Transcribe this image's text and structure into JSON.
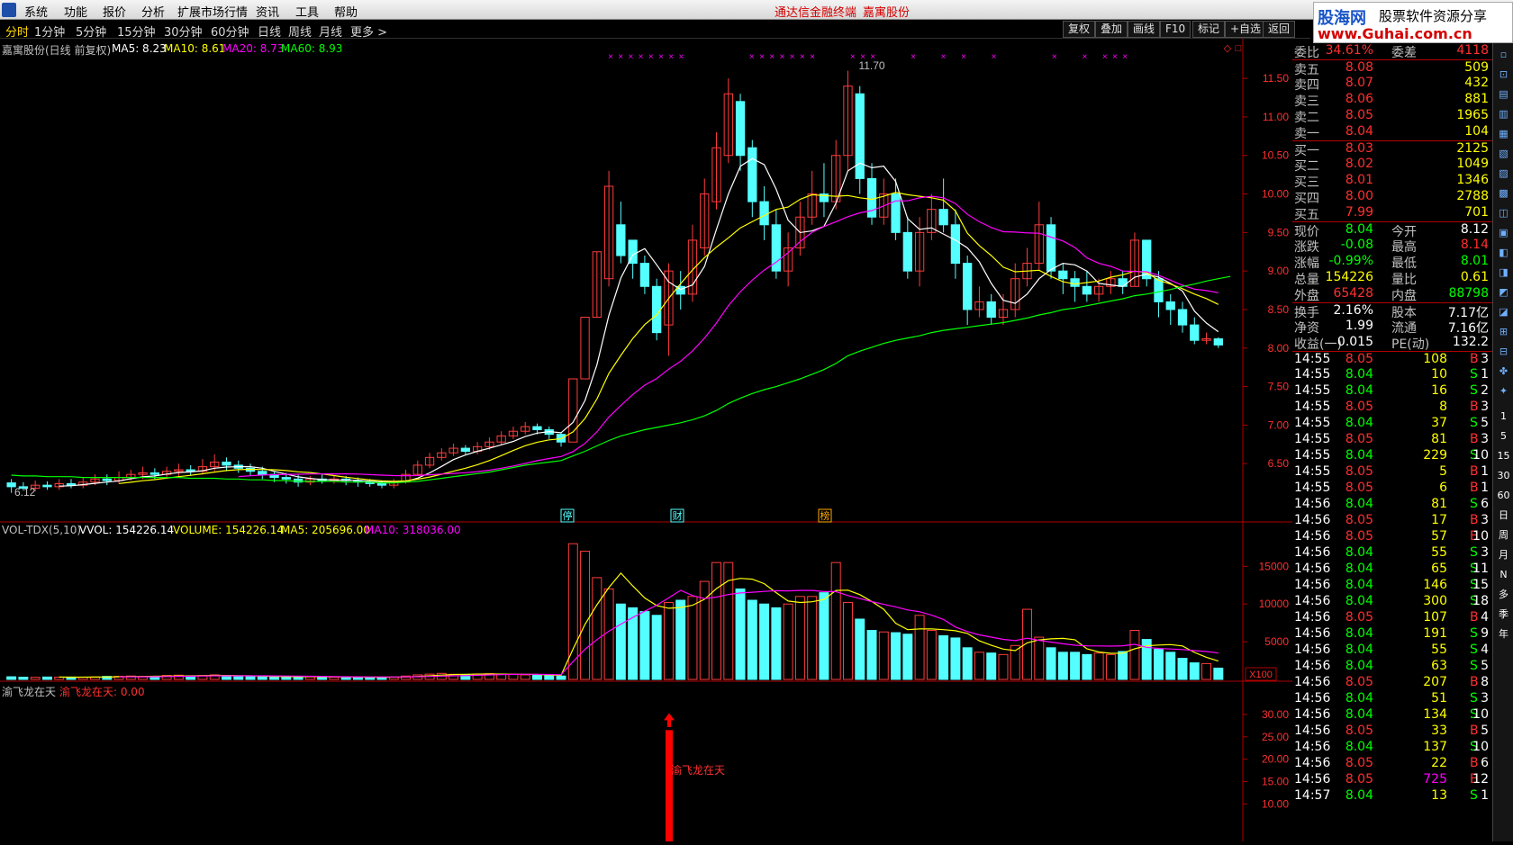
{
  "menu": {
    "items": [
      "系统",
      "功能",
      "报价",
      "分析",
      "扩展市场行情",
      "资讯",
      "工具",
      "帮助"
    ],
    "title": "通达信金融终端",
    "stock": "嘉寓股份"
  },
  "site_banner": {
    "brand": "股海网",
    "slogan": "股票软件资源分享",
    "url": "www.Guhai.com.cn"
  },
  "periods": [
    "分时",
    "1分钟",
    "5分钟",
    "15分钟",
    "30分钟",
    "60分钟",
    "日线",
    "周线",
    "月线",
    "更多 >"
  ],
  "active_period": "分时",
  "right_buttons": [
    "复权",
    "叠加",
    "画线",
    "F10",
    "标记",
    "+自选",
    "返回"
  ],
  "main_panel": {
    "stock_name": "嘉寓股份(日线 前复权)",
    "ma_labels": [
      {
        "text": "MA5: 8.23",
        "color": "#ffffff"
      },
      {
        "text": "MA10: 8.61",
        "color": "#ffff00"
      },
      {
        "text": "MA20: 8.73",
        "color": "#ff00ff"
      },
      {
        "text": "MA60: 8.93",
        "color": "#00ff00"
      }
    ],
    "high_label": "11.70",
    "low_label": "6.12",
    "event_markers": [
      "停",
      "财",
      "榜"
    ],
    "y_ticks": [
      "11.50",
      "11.00",
      "10.50",
      "10.00",
      "9.50",
      "9.00",
      "8.50",
      "8.00",
      "7.50",
      "7.00",
      "6.50"
    ]
  },
  "vol_panel": {
    "labels": [
      {
        "text": "VOL-TDX(5,10)",
        "color": "#c0c0c0"
      },
      {
        "text": "VVOL: 154226.14",
        "color": "#ffffff"
      },
      {
        "text": "VOLUME: 154226.14",
        "color": "#ffff00"
      },
      {
        "text": "MA5: 205696.00",
        "color": "#ffff00"
      },
      {
        "text": "MA10: 318036.00",
        "color": "#ff00ff"
      }
    ],
    "y_ticks": [
      "15000",
      "10000",
      "5000"
    ],
    "unit": "X100"
  },
  "indicator_panel": {
    "name": "渝飞龙在天",
    "value_label": "渝飞龙在天: 0.00",
    "signal_label": "渝飞龙在天",
    "y_ticks": [
      "30.00",
      "25.00",
      "20.00",
      "15.00",
      "10.00"
    ]
  },
  "chart_data": {
    "type": "candlestick",
    "y_range": [
      6.0,
      11.7
    ],
    "candles": [
      [
        6.25,
        6.2,
        6.3,
        6.12
      ],
      [
        6.2,
        6.18,
        6.26,
        6.15
      ],
      [
        6.18,
        6.22,
        6.28,
        6.14
      ],
      [
        6.22,
        6.2,
        6.27,
        6.16
      ],
      [
        6.2,
        6.24,
        6.3,
        6.16
      ],
      [
        6.24,
        6.22,
        6.3,
        6.18
      ],
      [
        6.22,
        6.26,
        6.32,
        6.18
      ],
      [
        6.26,
        6.3,
        6.36,
        6.22
      ],
      [
        6.3,
        6.28,
        6.36,
        6.22
      ],
      [
        6.28,
        6.32,
        6.4,
        6.24
      ],
      [
        6.32,
        6.36,
        6.42,
        6.28
      ],
      [
        6.36,
        6.38,
        6.46,
        6.3
      ],
      [
        6.38,
        6.36,
        6.44,
        6.3
      ],
      [
        6.36,
        6.4,
        6.46,
        6.32
      ],
      [
        6.4,
        6.42,
        6.5,
        6.34
      ],
      [
        6.42,
        6.4,
        6.48,
        6.34
      ],
      [
        6.4,
        6.46,
        6.56,
        6.36
      ],
      [
        6.46,
        6.52,
        6.62,
        6.4
      ],
      [
        6.52,
        6.48,
        6.58,
        6.4
      ],
      [
        6.48,
        6.44,
        6.54,
        6.38
      ],
      [
        6.44,
        6.4,
        6.5,
        6.34
      ],
      [
        6.4,
        6.36,
        6.46,
        6.3
      ],
      [
        6.36,
        6.32,
        6.4,
        6.26
      ],
      [
        6.32,
        6.3,
        6.38,
        6.24
      ],
      [
        6.3,
        6.26,
        6.36,
        6.2
      ],
      [
        6.26,
        6.3,
        6.34,
        6.22
      ],
      [
        6.3,
        6.28,
        6.36,
        6.24
      ],
      [
        6.28,
        6.3,
        6.34,
        6.24
      ],
      [
        6.3,
        6.28,
        6.34,
        6.22
      ],
      [
        6.28,
        6.26,
        6.32,
        6.2
      ],
      [
        6.26,
        6.24,
        6.3,
        6.2
      ],
      [
        6.24,
        6.22,
        6.28,
        6.18
      ],
      [
        6.22,
        6.26,
        6.3,
        6.18
      ],
      [
        6.26,
        6.36,
        6.42,
        6.24
      ],
      [
        6.36,
        6.48,
        6.54,
        6.34
      ],
      [
        6.48,
        6.58,
        6.64,
        6.44
      ],
      [
        6.58,
        6.64,
        6.7,
        6.54
      ],
      [
        6.64,
        6.7,
        6.76,
        6.6
      ],
      [
        6.7,
        6.66,
        6.74,
        6.62
      ],
      [
        6.66,
        6.72,
        6.78,
        6.62
      ],
      [
        6.72,
        6.78,
        6.84,
        6.68
      ],
      [
        6.78,
        6.86,
        6.92,
        6.74
      ],
      [
        6.86,
        6.92,
        6.98,
        6.82
      ],
      [
        6.92,
        6.98,
        7.04,
        6.88
      ],
      [
        6.98,
        6.94,
        7.02,
        6.88
      ],
      [
        6.94,
        6.88,
        6.98,
        6.82
      ],
      [
        6.88,
        6.78,
        6.9,
        6.72
      ],
      [
        6.78,
        7.6,
        7.6,
        7.6
      ],
      [
        7.6,
        8.4,
        8.4,
        8.4
      ],
      [
        8.4,
        9.25,
        9.25,
        8.4
      ],
      [
        8.9,
        10.1,
        10.3,
        8.8
      ],
      [
        9.6,
        9.2,
        9.9,
        9.1
      ],
      [
        9.4,
        9.1,
        9.3,
        8.9
      ],
      [
        9.1,
        8.8,
        9.2,
        8.7
      ],
      [
        8.8,
        8.2,
        8.9,
        8.1
      ],
      [
        8.3,
        9.0,
        9.1,
        7.9
      ],
      [
        8.8,
        8.7,
        9.0,
        8.5
      ],
      [
        8.7,
        9.4,
        9.6,
        8.6
      ],
      [
        9.3,
        10.0,
        10.2,
        9.2
      ],
      [
        9.9,
        10.6,
        10.8,
        9.8
      ],
      [
        10.5,
        11.3,
        11.5,
        10.4
      ],
      [
        11.2,
        10.5,
        11.3,
        10.3
      ],
      [
        10.6,
        9.9,
        10.7,
        9.7
      ],
      [
        9.9,
        9.6,
        10.1,
        9.4
      ],
      [
        9.6,
        9.0,
        9.8,
        8.9
      ],
      [
        9.0,
        9.3,
        9.5,
        8.8
      ],
      [
        9.3,
        9.7,
        9.9,
        9.2
      ],
      [
        9.7,
        10.0,
        10.3,
        9.6
      ],
      [
        10.0,
        9.9,
        10.4,
        9.7
      ],
      [
        9.9,
        10.5,
        10.7,
        9.8
      ],
      [
        10.5,
        11.4,
        11.6,
        10.3
      ],
      [
        11.3,
        10.2,
        11.4,
        10.0
      ],
      [
        10.2,
        9.7,
        10.4,
        9.6
      ],
      [
        9.7,
        10.0,
        10.2,
        9.6
      ],
      [
        10.0,
        9.5,
        10.2,
        9.4
      ],
      [
        9.5,
        9.0,
        9.7,
        8.9
      ],
      [
        9.0,
        9.5,
        9.7,
        8.8
      ],
      [
        9.5,
        9.8,
        10.0,
        9.4
      ],
      [
        9.8,
        9.6,
        10.2,
        9.5
      ],
      [
        9.6,
        9.1,
        9.8,
        8.9
      ],
      [
        9.1,
        8.5,
        9.2,
        8.3
      ],
      [
        8.5,
        8.6,
        8.8,
        8.4
      ],
      [
        8.6,
        8.4,
        8.7,
        8.3
      ],
      [
        8.4,
        8.5,
        8.7,
        8.3
      ],
      [
        8.5,
        8.9,
        9.1,
        8.4
      ],
      [
        8.9,
        9.1,
        9.3,
        8.8
      ],
      [
        9.1,
        9.6,
        9.9,
        9.0
      ],
      [
        9.6,
        9.0,
        9.7,
        8.9
      ],
      [
        9.0,
        8.9,
        9.1,
        8.7
      ],
      [
        8.9,
        8.8,
        9.0,
        8.6
      ],
      [
        8.8,
        8.7,
        9.0,
        8.6
      ],
      [
        8.7,
        8.8,
        8.9,
        8.6
      ],
      [
        8.8,
        8.9,
        9.0,
        8.7
      ],
      [
        8.9,
        8.8,
        9.0,
        8.7
      ],
      [
        8.8,
        9.4,
        9.5,
        8.8
      ],
      [
        9.4,
        8.9,
        9.4,
        8.8
      ],
      [
        8.9,
        8.6,
        9.0,
        8.4
      ],
      [
        8.6,
        8.5,
        8.7,
        8.3
      ],
      [
        8.5,
        8.3,
        8.6,
        8.2
      ],
      [
        8.3,
        8.1,
        8.4,
        8.05
      ],
      [
        8.1,
        8.12,
        8.2,
        8.05
      ],
      [
        8.12,
        8.04,
        8.14,
        8.0
      ]
    ],
    "volume": [
      350,
      300,
      280,
      320,
      300,
      310,
      290,
      330,
      400,
      420,
      450,
      380,
      420,
      520,
      560,
      480,
      520,
      600,
      480,
      420,
      380,
      350,
      400,
      380,
      360,
      340,
      320,
      300,
      330,
      290,
      280,
      300,
      320,
      450,
      600,
      700,
      800,
      680,
      650,
      720,
      760,
      700,
      650,
      600,
      550,
      500,
      450,
      18000,
      17000,
      13500,
      12000,
      10000,
      9500,
      9000,
      8500,
      10200,
      10500,
      11000,
      13000,
      15500,
      15500,
      12000,
      10500,
      10000,
      9500,
      10000,
      11000,
      11000,
      11500,
      15500,
      10200,
      8000,
      6500,
      6300,
      6200,
      6000,
      8500,
      6500,
      5800,
      5500,
      4200,
      3600,
      3500,
      3300,
      4500,
      9300,
      5600,
      4200,
      3600,
      3600,
      3300,
      3500,
      3300,
      3700,
      6500,
      5300,
      4000,
      3600,
      2800,
      2200,
      2100,
      1500
    ],
    "ma60": [
      6.35,
      6.34,
      6.34,
      6.33,
      6.33,
      6.33,
      6.32,
      6.32,
      6.32,
      6.32,
      6.32,
      6.32,
      6.32,
      6.32,
      6.32,
      6.31,
      6.31,
      6.31,
      6.3,
      6.3,
      6.29,
      6.29,
      6.28,
      6.28,
      6.27,
      6.27,
      6.27,
      6.27,
      6.26,
      6.26,
      6.26,
      6.25,
      6.25,
      6.26,
      6.27,
      6.29,
      6.31,
      6.33,
      6.35,
      6.37,
      6.39,
      6.42,
      6.45,
      6.48,
      6.5,
      6.52,
      6.54,
      6.6,
      6.66,
      6.73,
      6.8,
      6.86,
      6.9,
      6.94,
      6.97,
      7.0,
      7.03,
      7.07,
      7.12,
      7.19,
      7.28,
      7.35,
      7.41,
      7.46,
      7.5,
      7.55,
      7.6,
      7.66,
      7.72,
      7.8,
      7.9,
      7.96,
      8.01,
      8.06,
      8.1,
      8.13,
      8.16,
      8.2,
      8.23,
      8.25,
      8.27,
      8.29,
      8.31,
      8.33,
      8.36,
      8.39,
      8.43,
      8.46,
      8.5,
      8.52,
      8.55,
      8.58,
      8.61,
      8.64,
      8.68,
      8.7,
      8.73,
      8.76,
      8.8,
      8.83,
      8.87,
      8.9,
      8.93
    ]
  },
  "quote": {
    "webi": {
      "label": "委比",
      "value": "34.61%",
      "label2": "委差",
      "value2": "4118"
    },
    "asks": [
      {
        "label": "卖五",
        "price": "8.08",
        "vol": "509"
      },
      {
        "label": "卖四",
        "price": "8.07",
        "vol": "432"
      },
      {
        "label": "卖三",
        "price": "8.06",
        "vol": "881"
      },
      {
        "label": "卖二",
        "price": "8.05",
        "vol": "1965"
      },
      {
        "label": "卖一",
        "price": "8.04",
        "vol": "104"
      }
    ],
    "bids": [
      {
        "label": "买一",
        "price": "8.03",
        "vol": "2125"
      },
      {
        "label": "买二",
        "price": "8.02",
        "vol": "1049"
      },
      {
        "label": "买三",
        "price": "8.01",
        "vol": "1346"
      },
      {
        "label": "买四",
        "price": "8.00",
        "vol": "2788"
      },
      {
        "label": "买五",
        "price": "7.99",
        "vol": "701"
      }
    ],
    "stats": [
      {
        "l1": "现价",
        "v1": "8.04",
        "c1": "#00ff00",
        "l2": "今开",
        "v2": "8.12",
        "c2": "#ffffff"
      },
      {
        "l1": "涨跌",
        "v1": "-0.08",
        "c1": "#00ff00",
        "l2": "最高",
        "v2": "8.14",
        "c2": "#ff3030"
      },
      {
        "l1": "涨幅",
        "v1": "-0.99%",
        "c1": "#00ff00",
        "l2": "最低",
        "v2": "8.01",
        "c2": "#00ff00"
      },
      {
        "l1": "总量",
        "v1": "154226",
        "c1": "#ffff00",
        "l2": "量比",
        "v2": "0.61",
        "c2": "#ffff00"
      },
      {
        "l1": "外盘",
        "v1": "65428",
        "c1": "#ff3030",
        "l2": "内盘",
        "v2": "88798",
        "c2": "#00ff00"
      }
    ],
    "stats2": [
      {
        "l1": "换手",
        "v1": "2.16%",
        "l2": "股本",
        "v2": "7.17亿"
      },
      {
        "l1": "净资",
        "v1": "1.99",
        "l2": "流通",
        "v2": "7.16亿"
      },
      {
        "l1": "收益(一)",
        "v1": "0.015",
        "l2": "PE(动)",
        "v2": "132.2"
      }
    ],
    "ticks": [
      {
        "t": "14:55",
        "p": "8.05",
        "v": "108",
        "d": "B",
        "n": "3"
      },
      {
        "t": "14:55",
        "p": "8.04",
        "v": "10",
        "d": "S",
        "n": "1"
      },
      {
        "t": "14:55",
        "p": "8.04",
        "v": "16",
        "d": "S",
        "n": "2"
      },
      {
        "t": "14:55",
        "p": "8.05",
        "v": "8",
        "d": "B",
        "n": "3"
      },
      {
        "t": "14:55",
        "p": "8.04",
        "v": "37",
        "d": "S",
        "n": "5"
      },
      {
        "t": "14:55",
        "p": "8.05",
        "v": "81",
        "d": "B",
        "n": "3"
      },
      {
        "t": "14:55",
        "p": "8.04",
        "v": "229",
        "d": "S",
        "n": "10"
      },
      {
        "t": "14:55",
        "p": "8.05",
        "v": "5",
        "d": "B",
        "n": "1"
      },
      {
        "t": "14:55",
        "p": "8.05",
        "v": "6",
        "d": "B",
        "n": "1"
      },
      {
        "t": "14:56",
        "p": "8.04",
        "v": "81",
        "d": "S",
        "n": "6"
      },
      {
        "t": "14:56",
        "p": "8.05",
        "v": "17",
        "d": "B",
        "n": "3"
      },
      {
        "t": "14:56",
        "p": "8.05",
        "v": "57",
        "d": "B",
        "n": "10"
      },
      {
        "t": "14:56",
        "p": "8.04",
        "v": "55",
        "d": "S",
        "n": "3"
      },
      {
        "t": "14:56",
        "p": "8.04",
        "v": "65",
        "d": "S",
        "n": "11"
      },
      {
        "t": "14:56",
        "p": "8.04",
        "v": "146",
        "d": "S",
        "n": "15"
      },
      {
        "t": "14:56",
        "p": "8.04",
        "v": "300",
        "d": "S",
        "n": "18"
      },
      {
        "t": "14:56",
        "p": "8.05",
        "v": "107",
        "d": "B",
        "n": "4"
      },
      {
        "t": "14:56",
        "p": "8.04",
        "v": "191",
        "d": "S",
        "n": "9"
      },
      {
        "t": "14:56",
        "p": "8.04",
        "v": "55",
        "d": "S",
        "n": "4"
      },
      {
        "t": "14:56",
        "p": "8.04",
        "v": "63",
        "d": "S",
        "n": "5"
      },
      {
        "t": "14:56",
        "p": "8.05",
        "v": "207",
        "d": "B",
        "n": "8"
      },
      {
        "t": "14:56",
        "p": "8.04",
        "v": "51",
        "d": "S",
        "n": "3"
      },
      {
        "t": "14:56",
        "p": "8.04",
        "v": "134",
        "d": "S",
        "n": "10"
      },
      {
        "t": "14:56",
        "p": "8.05",
        "v": "33",
        "d": "B",
        "n": "5"
      },
      {
        "t": "14:56",
        "p": "8.04",
        "v": "137",
        "d": "S",
        "n": "10"
      },
      {
        "t": "14:56",
        "p": "8.05",
        "v": "22",
        "d": "B",
        "n": "6"
      },
      {
        "t": "14:56",
        "p": "8.05",
        "v": "725",
        "d": "B",
        "n": "12"
      },
      {
        "t": "14:57",
        "p": "8.04",
        "v": "13",
        "d": "S",
        "n": "1"
      }
    ]
  },
  "side_toolbar": [
    "1",
    "5",
    "15",
    "30",
    "60",
    "日",
    "周",
    "月",
    "N",
    "多",
    "季",
    "年"
  ]
}
